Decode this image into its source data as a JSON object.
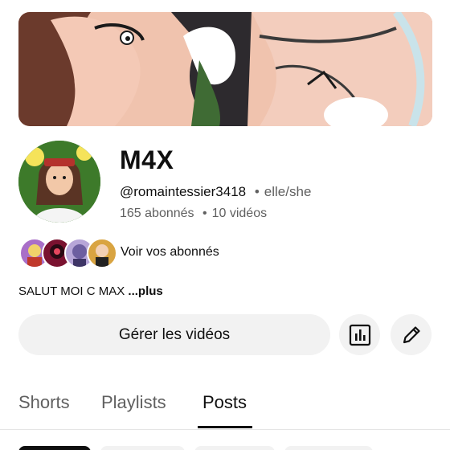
{
  "channel": {
    "name": "M4X",
    "handle": "@romaintessier3418",
    "pronouns": "elle/she",
    "subscribers": "165 abonnés",
    "videos": "10 vidéos",
    "separator": "•"
  },
  "subscribers_row": {
    "link_label": "Voir vos abonnés",
    "avatar_count": 4
  },
  "description": {
    "text": "SALUT MOI C MAX",
    "more_label": "...plus"
  },
  "actions": {
    "manage_videos_label": "Gérer les vidéos",
    "analytics_icon": "analytics-icon",
    "edit_icon": "pencil-icon"
  },
  "tabs": [
    {
      "label": "Shorts",
      "active": false
    },
    {
      "label": "Playlists",
      "active": false
    },
    {
      "label": "Posts",
      "active": true
    }
  ],
  "colors": {
    "text_primary": "#0f0f0f",
    "text_secondary": "#606060",
    "button_bg": "#f2f2f2"
  }
}
